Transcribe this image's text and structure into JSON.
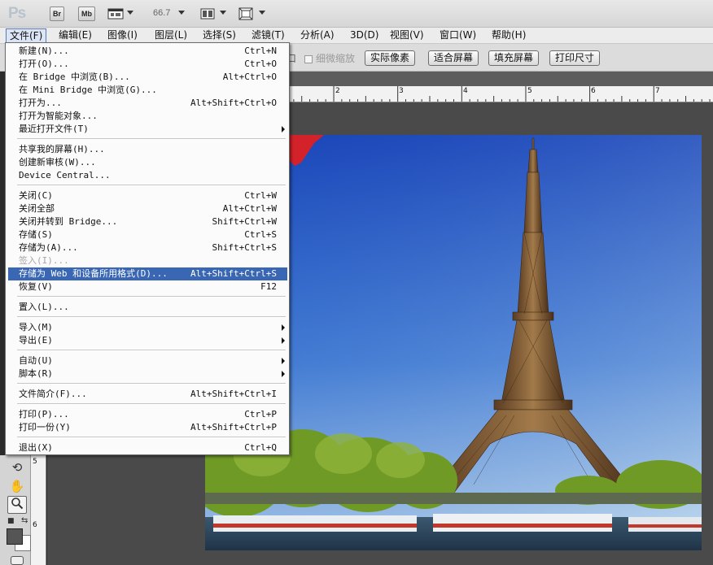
{
  "app_bar": {
    "logo": "Ps",
    "bridge_btn": "Br",
    "minibridge_btn": "Mb",
    "zoom": "66.7",
    "view_extras_icon": "film-frame-icon",
    "arrange_icon": "arrange-documents-icon",
    "screen_mode_icon": "screen-mode-icon"
  },
  "menu_bar": [
    {
      "label": "文件(F)",
      "active": true
    },
    {
      "label": "编辑(E)"
    },
    {
      "label": "图像(I)"
    },
    {
      "label": "图层(L)"
    },
    {
      "label": "选择(S)"
    },
    {
      "label": "滤镜(T)"
    },
    {
      "label": "分析(A)"
    },
    {
      "label": "3D(D)"
    },
    {
      "label": "视图(V)"
    },
    {
      "label": "窗口(W)"
    },
    {
      "label": "帮助(H)"
    }
  ],
  "options_bar": {
    "partial_label": "口",
    "scrubby_zoom_label": "细微缩放",
    "buttons": [
      "实际像素",
      "适合屏幕",
      "填充屏幕",
      "打印尺寸"
    ]
  },
  "ruler": {
    "h_labels": [
      "2",
      "3",
      "4",
      "5",
      "6",
      "7"
    ],
    "v_labels": [
      "5",
      "6"
    ]
  },
  "file_menu": {
    "items": [
      {
        "label": "新建(N)...",
        "shortcut": "Ctrl+N"
      },
      {
        "label": "打开(O)...",
        "shortcut": "Ctrl+O"
      },
      {
        "label": "在 Bridge 中浏览(B)...",
        "shortcut": "Alt+Ctrl+O"
      },
      {
        "label": "在 Mini Bridge 中浏览(G)...",
        "shortcut": ""
      },
      {
        "label": "打开为...",
        "shortcut": "Alt+Shift+Ctrl+O"
      },
      {
        "label": "打开为智能对象...",
        "shortcut": ""
      },
      {
        "label": "最近打开文件(T)",
        "shortcut": "",
        "submenu": true
      },
      {
        "separator": true
      },
      {
        "label": "共享我的屏幕(H)...",
        "shortcut": ""
      },
      {
        "label": "创建新审核(W)...",
        "shortcut": ""
      },
      {
        "label": "Device Central...",
        "shortcut": ""
      },
      {
        "separator": true
      },
      {
        "label": "关闭(C)",
        "shortcut": "Ctrl+W"
      },
      {
        "label": "关闭全部",
        "shortcut": "Alt+Ctrl+W"
      },
      {
        "label": "关闭并转到 Bridge...",
        "shortcut": "Shift+Ctrl+W"
      },
      {
        "label": "存储(S)",
        "shortcut": "Ctrl+S"
      },
      {
        "label": "存储为(A)...",
        "shortcut": "Shift+Ctrl+S"
      },
      {
        "label": "签入(I)...",
        "shortcut": "",
        "disabled": true
      },
      {
        "label": "存储为 Web 和设备所用格式(D)...",
        "shortcut": "Alt+Shift+Ctrl+S",
        "highlighted": true
      },
      {
        "label": "恢复(V)",
        "shortcut": "F12"
      },
      {
        "separator": true
      },
      {
        "label": "置入(L)...",
        "shortcut": ""
      },
      {
        "separator": true
      },
      {
        "label": "导入(M)",
        "shortcut": "",
        "submenu": true
      },
      {
        "label": "导出(E)",
        "shortcut": "",
        "submenu": true
      },
      {
        "separator": true
      },
      {
        "label": "自动(U)",
        "shortcut": "",
        "submenu": true
      },
      {
        "label": "脚本(R)",
        "shortcut": "",
        "submenu": true
      },
      {
        "separator": true
      },
      {
        "label": "文件简介(F)...",
        "shortcut": "Alt+Shift+Ctrl+I"
      },
      {
        "separator": true
      },
      {
        "label": "打印(P)...",
        "shortcut": "Ctrl+P"
      },
      {
        "label": "打印一份(Y)",
        "shortcut": "Alt+Shift+Ctrl+P"
      },
      {
        "separator": true
      },
      {
        "label": "退出(X)",
        "shortcut": "Ctrl+Q"
      }
    ]
  },
  "tools": [
    {
      "icon": "rotate-view-icon",
      "glyph": "⟲"
    },
    {
      "icon": "hand-tool-icon",
      "glyph": "✋"
    },
    {
      "icon": "zoom-tool-icon",
      "glyph": "🔍"
    }
  ],
  "colors": {
    "menu_highlight": "#3a67b4",
    "foreground_swatch": "#555555",
    "background_swatch": "#ffffff"
  }
}
